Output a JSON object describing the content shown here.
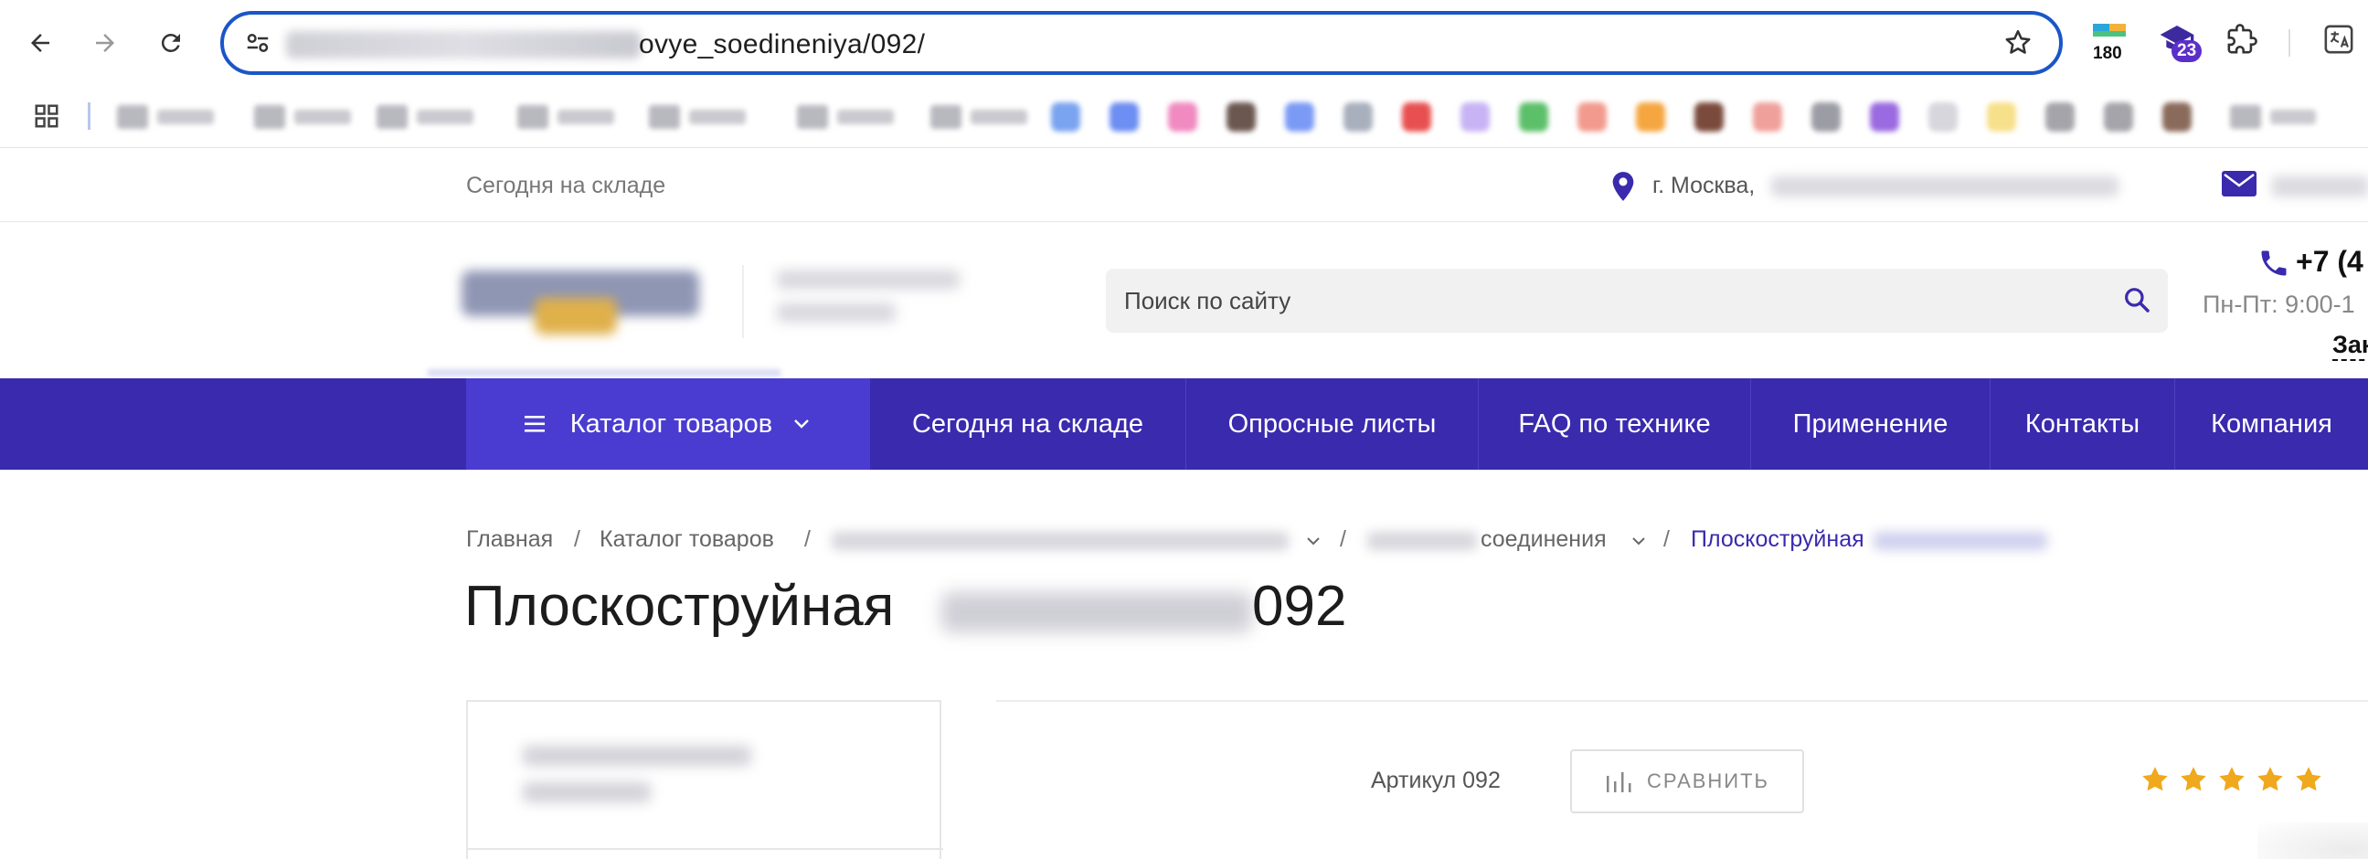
{
  "browser": {
    "url_visible": "ovye_soedineniya/092/",
    "extensions": [
      {
        "name": "counter-extension",
        "label": "180"
      },
      {
        "name": "graduation-extension",
        "badge": "23"
      }
    ]
  },
  "topbar": {
    "stock_link": "Сегодня на складе",
    "city": "г. Москва,"
  },
  "header": {
    "search_placeholder": "Поиск по сайту",
    "phone": "+7 (4",
    "hours": "Пн-Пт: 9:00-1",
    "callback": "Зак"
  },
  "menu": {
    "items": [
      {
        "label": "Каталог товаров"
      },
      {
        "label": "Сегодня на складе"
      },
      {
        "label": "Опросные листы"
      },
      {
        "label": "FAQ по технике"
      },
      {
        "label": "Применение"
      },
      {
        "label": "Контакты"
      },
      {
        "label": "Компания"
      }
    ]
  },
  "breadcrumbs": {
    "home": "Главная",
    "catalog": "Каталог товаров",
    "sep": "/",
    "section_tail": "соединения",
    "current": "Плоскоструйная"
  },
  "product": {
    "title": "Плоскоструйная",
    "title_tail": "092",
    "sku": "Артикул 092",
    "compare_label": "СРАВНИТЬ",
    "rating": 5
  },
  "colors": {
    "accent": "#3a2aad",
    "menu_active": "#4a3cd0",
    "star": "#f0a81c",
    "omnibox_border": "#1a56c8"
  }
}
